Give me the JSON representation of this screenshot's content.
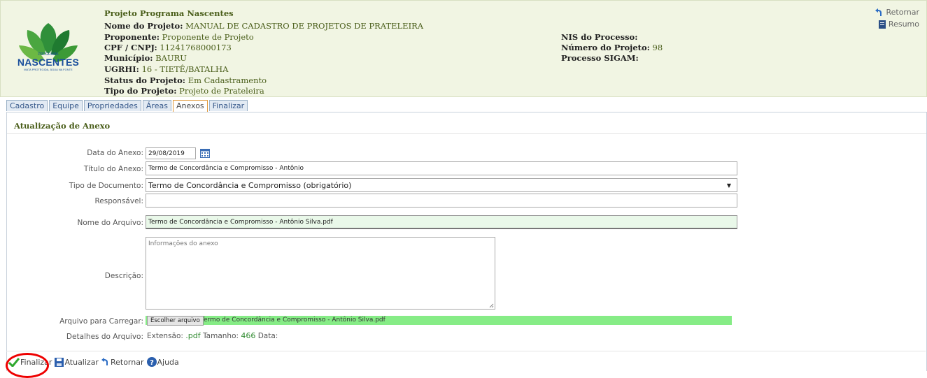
{
  "header": {
    "program": "Projeto Programa Nascentes",
    "logo_small": "PROGRAMA",
    "logo_text": "NASCENTES",
    "logo_tagline": "MATA PROTEGIDA, ÁGUA NA FONTE",
    "fields_left": [
      {
        "label": "Nome do Projeto:",
        "value": "MANUAL DE CADASTRO DE PROJETOS DE PRATELEIRA"
      },
      {
        "label": "Proponente:",
        "value": "Proponente de Projeto"
      },
      {
        "label": "CPF / CNPJ:",
        "value": "11241768000173"
      },
      {
        "label": "Município:",
        "value": "BAURU"
      },
      {
        "label": "UGRHI:",
        "value": "16 - TIETÊ/BATALHA"
      },
      {
        "label": "Status do Projeto:",
        "value": "Em Cadastramento"
      },
      {
        "label": "Tipo do Projeto:",
        "value": "Projeto de Prateleira"
      }
    ],
    "fields_right": [
      {
        "label": "NIS do Processo:",
        "value": ""
      },
      {
        "label": "Número do Projeto:",
        "value": "98"
      },
      {
        "label": "Processo SIGAM:",
        "value": ""
      }
    ],
    "links": {
      "retornar": "Retornar",
      "resumo": "Resumo"
    }
  },
  "tabs": [
    {
      "label": "Cadastro",
      "active": false
    },
    {
      "label": "Equipe",
      "active": false
    },
    {
      "label": "Propriedades",
      "active": false
    },
    {
      "label": "Áreas",
      "active": false
    },
    {
      "label": "Anexos",
      "active": true
    },
    {
      "label": "Finalizar",
      "active": false
    }
  ],
  "panel": {
    "title": "Atualização de Anexo",
    "labels": {
      "data": "Data do Anexo:",
      "titulo": "Título do Anexo:",
      "tipo": "Tipo de Documento:",
      "responsavel": "Responsável:",
      "nome_arquivo": "Nome do Arquivo:",
      "descricao": "Descrição:",
      "arquivo_carregar": "Arquivo para Carregar:",
      "detalhes": "Detalhes do Arquivo:"
    },
    "values": {
      "data": "29/08/2019",
      "titulo": "Termo de Concordância e Compromisso - Antônio",
      "tipo": "Termo de Concordância e Compromisso (obrigatório)",
      "responsavel": "",
      "nome_arquivo": "Termo de Concordância e Compromisso - Antônio Silva.pdf",
      "descricao_placeholder": "Informações do anexo",
      "file_button": "Escolher arquivo",
      "file_chosen": "Termo de Concordância e Compromisso - Antônio Silva.pdf"
    },
    "details": {
      "extensao_label": "Extensão:",
      "extensao": ".pdf",
      "tamanho_label": "Tamanho:",
      "tamanho": "466",
      "data_label": "Data:"
    }
  },
  "actions": {
    "finalizar": "Finalizar",
    "atualizar": "Atualizar",
    "retornar": "Retornar",
    "ajuda": "Ajuda"
  },
  "colors": {
    "header_bg": "#f1f5e3",
    "header_text": "#4a5e1a",
    "highlight_field": "#86ec86",
    "annotation_ring": "#ee0000"
  }
}
